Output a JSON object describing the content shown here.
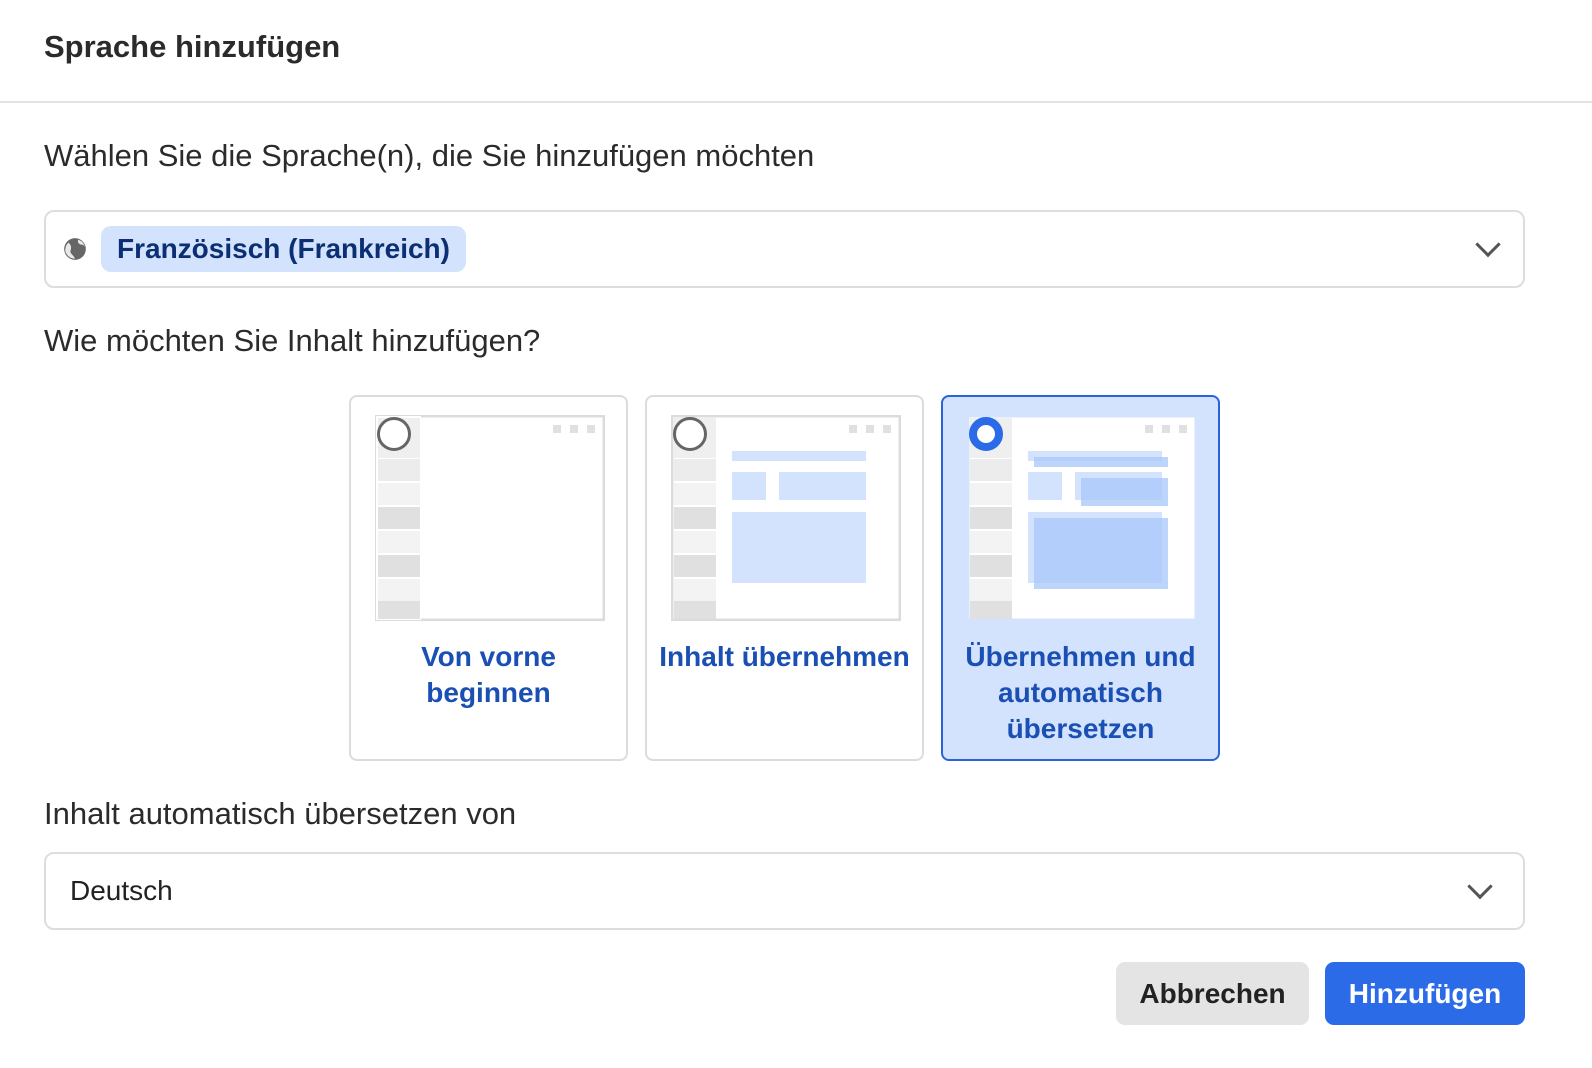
{
  "dialog": {
    "title": "Sprache hinzufügen"
  },
  "language_section": {
    "label": "Wählen Sie die Sprache(n), die Sie hinzufügen möchten",
    "selected_chip": "Französisch (Frankreich)",
    "icon": "globe-icon"
  },
  "content_section": {
    "label": "Wie möchten Sie Inhalt hinzufügen?",
    "options": [
      {
        "label": "Von vorne beginnen",
        "selected": false
      },
      {
        "label": "Inhalt übernehmen",
        "selected": false
      },
      {
        "label": "Übernehmen und automatisch übersetzen",
        "selected": true
      }
    ]
  },
  "translate_section": {
    "label": "Inhalt automatisch übersetzen von",
    "value": "Deutsch"
  },
  "footer": {
    "cancel_label": "Abbrechen",
    "add_label": "Hinzufügen"
  },
  "colors": {
    "accent": "#2b6be8",
    "chip_bg": "#d3e3fd",
    "chip_text": "#0b2f72",
    "option_label": "#1a4fb4"
  }
}
